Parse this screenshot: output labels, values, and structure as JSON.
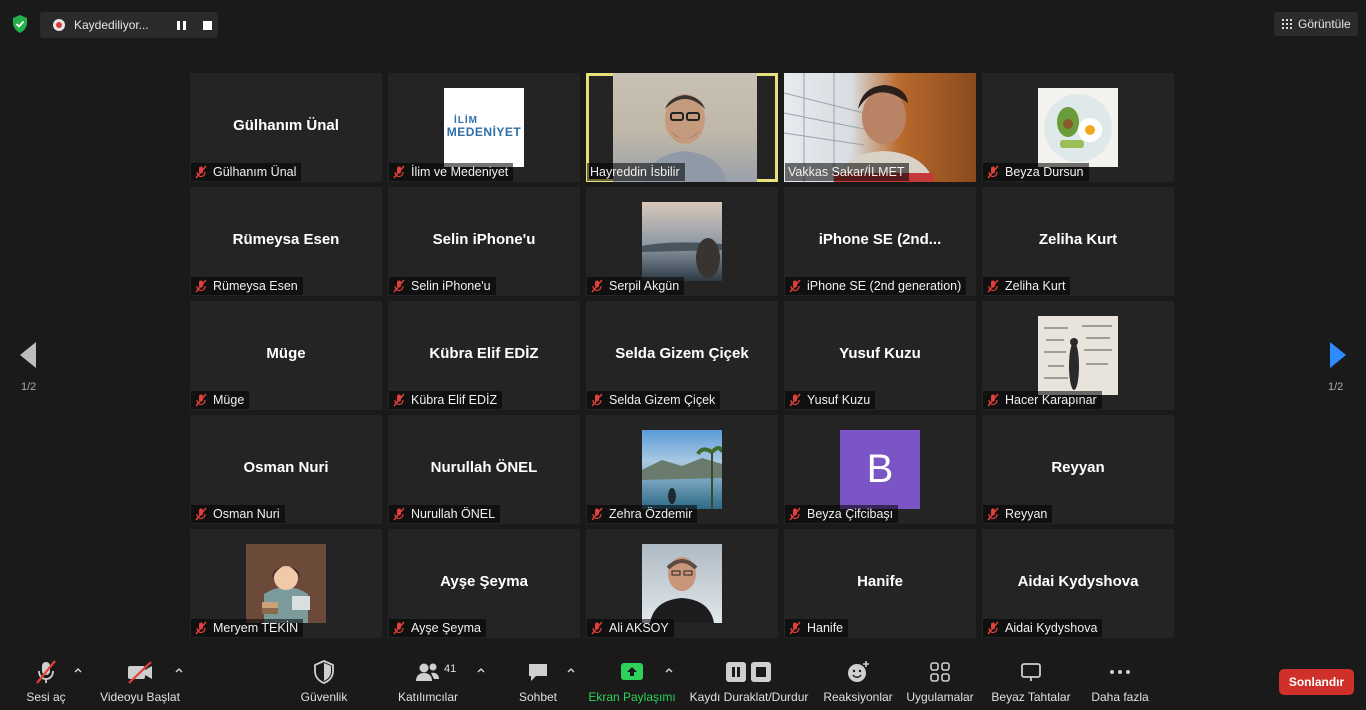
{
  "topbar": {
    "recording_label": "Kaydediliyor...",
    "view_label": "Görüntüle"
  },
  "pagination": {
    "prev_label": "1/2",
    "next_label": "1/2"
  },
  "tiles": [
    {
      "name": "Gülhanım Ünal",
      "caption": "Gülhanım Ünal",
      "kind": "name"
    },
    {
      "name": "",
      "caption": "İlim ve Medeniyet",
      "kind": "logo",
      "logo_line1": "İLİM",
      "logo_line2": "MEDENİYET"
    },
    {
      "name": "",
      "caption": "Hayreddin İsbilir",
      "kind": "video-active"
    },
    {
      "name": "",
      "caption": "Vakkas Sakar/İLMET",
      "kind": "video"
    },
    {
      "name": "",
      "caption": "Beyza Dursun",
      "kind": "photo-food"
    },
    {
      "name": "Rümeysa Esen",
      "caption": "Rümeysa Esen",
      "kind": "name"
    },
    {
      "name": "Selin iPhone'u",
      "caption": "Selin iPhone'u",
      "kind": "name"
    },
    {
      "name": "",
      "caption": "Serpil Akgün",
      "kind": "photo-bridge"
    },
    {
      "name": "iPhone SE (2nd...",
      "caption": "iPhone SE (2nd generation)",
      "kind": "name"
    },
    {
      "name": "Zeliha Kurt",
      "caption": "Zeliha Kurt",
      "kind": "name"
    },
    {
      "name": "Müge",
      "caption": "Müge",
      "kind": "name"
    },
    {
      "name": "Kübra Elif EDİZ",
      "caption": "Kübra Elif EDİZ",
      "kind": "name"
    },
    {
      "name": "Selda Gizem Çiçek",
      "caption": "Selda Gizem Çiçek",
      "kind": "name"
    },
    {
      "name": "Yusuf Kuzu",
      "caption": "Yusuf Kuzu",
      "kind": "name"
    },
    {
      "name": "",
      "caption": "Hacer Karapınar",
      "kind": "photo-board"
    },
    {
      "name": "Osman Nuri",
      "caption": "Osman Nuri",
      "kind": "name"
    },
    {
      "name": "Nurullah ÖNEL",
      "caption": "Nurullah ÖNEL",
      "kind": "name"
    },
    {
      "name": "",
      "caption": "Zehra Özdemir",
      "kind": "photo-sea"
    },
    {
      "name": "",
      "caption": "Beyza Çifcibaşı",
      "kind": "letter",
      "letter": "B"
    },
    {
      "name": "Reyyan",
      "caption": "Reyyan",
      "kind": "name"
    },
    {
      "name": "",
      "caption": "Meryem TEKİN",
      "kind": "photo-illustration"
    },
    {
      "name": "Ayşe Şeyma",
      "caption": "Ayşe Şeyma",
      "kind": "name"
    },
    {
      "name": "",
      "caption": "Ali AKSOY",
      "kind": "photo-portrait"
    },
    {
      "name": "Hanife",
      "caption": "Hanife",
      "kind": "name"
    },
    {
      "name": "Aidai Kydyshova",
      "caption": "Aidai Kydyshova",
      "kind": "name"
    }
  ],
  "toolbar": {
    "unmute": "Sesi aç",
    "start_video": "Videoyu Başlat",
    "security": "Güvenlik",
    "participants": "Katılımcılar",
    "participants_count": "41",
    "chat": "Sohbet",
    "share_screen": "Ekran Paylaşımı",
    "record_controls": "Kaydı Duraklat/Durdur",
    "reactions": "Reaksiyonlar",
    "apps": "Uygulamalar",
    "whiteboards": "Beyaz Tahtalar",
    "more": "Daha fazla",
    "end": "Sonlandır"
  },
  "colors": {
    "background": "#1a1a1a",
    "tile": "#242424",
    "active_speaker": "#e6e27b",
    "mute_red": "#e0403a",
    "share_green": "#2ed15a",
    "end_red": "#d0302a",
    "nav_blue": "#2d8cff"
  }
}
